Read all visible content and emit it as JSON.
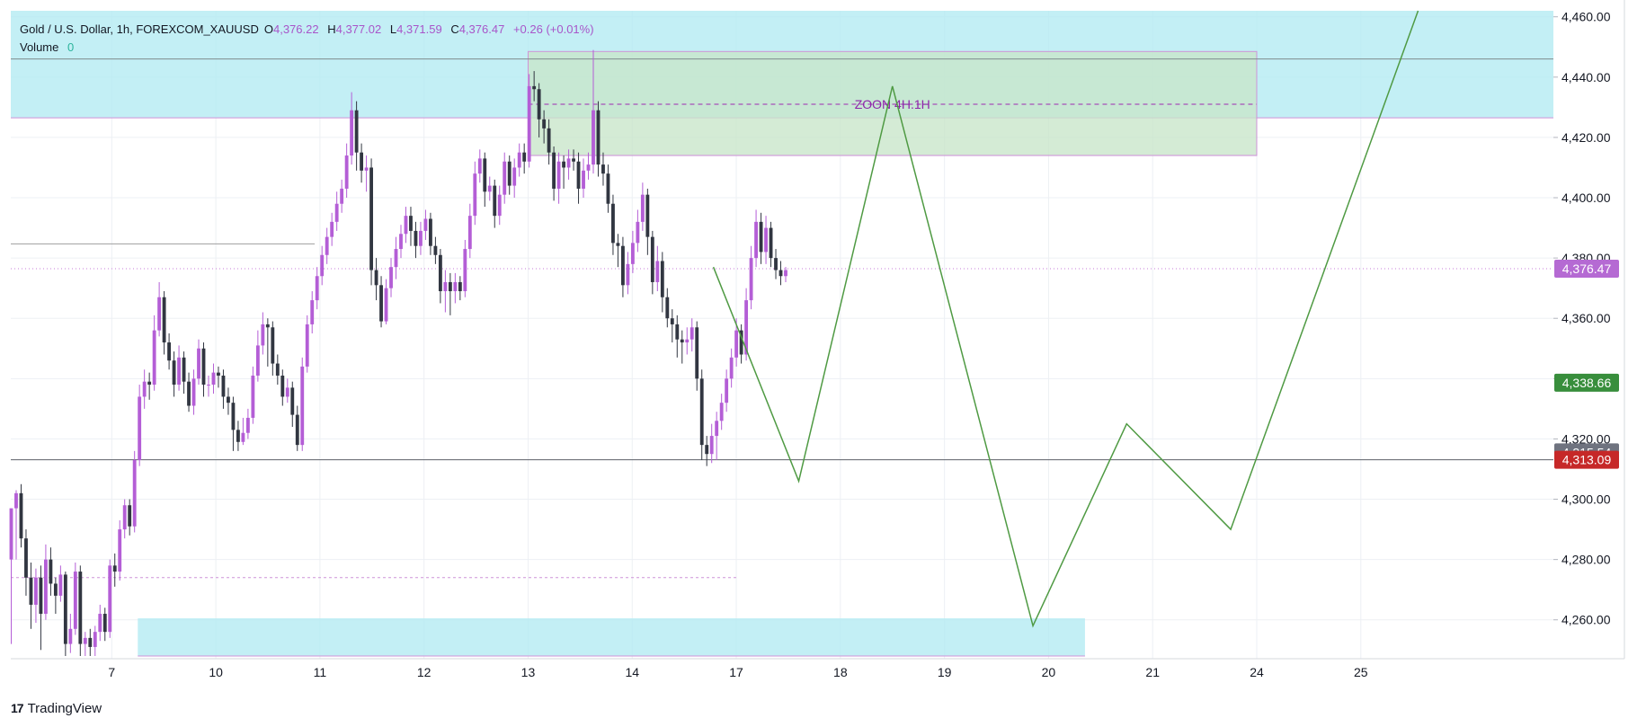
{
  "header": {
    "title": "Gold / U.S. Dollar, 1h, FOREXCOM_XAUUSD",
    "ohlc": {
      "open_label": "O",
      "open": "4,376.22",
      "high_label": "H",
      "high": "4,377.02",
      "low_label": "L",
      "low": "4,371.59",
      "close_label": "C",
      "close": "4,376.47",
      "change": "+0.26 (+0.01%)"
    },
    "volume_label": "Volume",
    "volume_value": "0"
  },
  "brand": {
    "label": "TradingView",
    "icon": "tradingview-logo-icon"
  },
  "chart_data": {
    "type": "candlestick",
    "symbol": "FOREXCOM_XAUUSD",
    "interval": "1h",
    "ylim": [
      4248,
      4462
    ],
    "yticks": [
      "4,460.00",
      "4,440.00",
      "4,420.00",
      "4,400.00",
      "4,380.00",
      "4,360.00",
      "4,340.00",
      "4,320.00",
      "4,300.00",
      "4,280.00",
      "4,260.00"
    ],
    "xticks": [
      "7",
      "10",
      "11",
      "12",
      "13",
      "14",
      "17",
      "18",
      "19",
      "20",
      "21",
      "24",
      "25"
    ],
    "xtick_pos": [
      1,
      2,
      3,
      4,
      5,
      6,
      7,
      8,
      9,
      10,
      11,
      12,
      13
    ],
    "xlim": [
      0.03,
      14.85
    ],
    "price_labels": [
      {
        "text": "4,376.47",
        "value": 4376.47,
        "color": "#b56ad3"
      },
      {
        "text": "4,338.66",
        "value": 4338.66,
        "color": "#388e3c"
      },
      {
        "text": "4,315.54",
        "value": 4315.54,
        "color": "#6f737f"
      },
      {
        "text": "4,313.09",
        "value": 4313.09,
        "color": "#c62828"
      }
    ],
    "zones": [
      {
        "x0": 0.03,
        "x1": 14.85,
        "y0": 4426.5,
        "y1": 4462,
        "fill": "#b2ebf2"
      },
      {
        "x0": 1.25,
        "x1": 10.35,
        "y0": 4248,
        "y1": 4260.5,
        "fill": "#b2ebf2"
      },
      {
        "x0": 5.0,
        "x1": 12.0,
        "y0": 4414,
        "y1": 4448.5,
        "fill": "#c8e6c9"
      }
    ],
    "zone_label": "ZOON 4H.1H",
    "zone_label_value": 4431,
    "horizontal_lines": [
      {
        "value": 4313.09,
        "x0": 0.03,
        "x1": 14.85,
        "color": "#5d6068"
      },
      {
        "value": 4446,
        "x0": 0.03,
        "x1": 14.85,
        "color": "#7f8c8d"
      },
      {
        "value": 4384.7,
        "x0": 0.03,
        "x1": 2.95,
        "color": "#9e9e9e"
      },
      {
        "value": 4274,
        "x0": 0.03,
        "x1": 7.0,
        "color": "#ce93d8",
        "dashed": true
      }
    ],
    "current_price": 4376.47,
    "projection": [
      [
        6.78,
        4377
      ],
      [
        7.6,
        4306
      ],
      [
        8.5,
        4437
      ],
      [
        9.85,
        4258
      ],
      [
        10.75,
        4325
      ],
      [
        11.75,
        4290
      ],
      [
        13.55,
        4462
      ]
    ],
    "candles": [
      [
        0,
        4280,
        4297,
        4292,
        4252
      ],
      [
        0,
        4297,
        4302,
        4303,
        4280
      ],
      [
        0,
        4302,
        4287,
        4305,
        4284
      ],
      [
        0,
        4287,
        4274,
        4290,
        4268
      ],
      [
        0,
        4274,
        4265,
        4279,
        4257
      ],
      [
        0,
        4265,
        4274,
        4277,
        4259
      ],
      [
        0,
        4274,
        4262,
        4278,
        4250
      ],
      [
        0,
        4262,
        4280,
        4285,
        4260
      ],
      [
        0,
        4280,
        4272,
        4284,
        4268
      ],
      [
        0,
        4272,
        4268,
        4274,
        4262
      ],
      [
        0,
        4268,
        4275,
        4278,
        4266
      ],
      [
        0,
        4275,
        4252,
        4276,
        4248
      ],
      [
        0,
        4252,
        4257,
        4262,
        4249
      ],
      [
        0,
        4257,
        4276,
        4279,
        4255
      ],
      [
        0,
        4276,
        4252,
        4278,
        4248
      ],
      [
        1,
        4252,
        4254,
        4256,
        4248
      ],
      [
        1,
        4254,
        4251,
        4257,
        4248
      ],
      [
        1,
        4251,
        4256,
        4258,
        4248
      ],
      [
        1,
        4256,
        4262,
        4265,
        4253
      ],
      [
        1,
        4262,
        4256,
        4264,
        4253
      ],
      [
        1,
        4256,
        4278,
        4280,
        4254
      ],
      [
        1,
        4278,
        4276,
        4282,
        4271
      ],
      [
        1,
        4276,
        4290,
        4293,
        4273
      ],
      [
        1,
        4290,
        4298,
        4300,
        4287
      ],
      [
        1,
        4298,
        4291,
        4300,
        4288
      ],
      [
        1,
        4291,
        4313,
        4316,
        4289
      ],
      [
        1,
        4313,
        4334,
        4338,
        4311
      ],
      [
        1,
        4334,
        4339,
        4343,
        4330
      ],
      [
        1,
        4339,
        4338,
        4342,
        4333
      ],
      [
        1,
        4338,
        4356,
        4361,
        4336
      ],
      [
        1,
        4356,
        4367,
        4372,
        4354
      ],
      [
        1,
        4367,
        4352,
        4369,
        4348
      ],
      [
        1,
        4352,
        4346,
        4355,
        4343
      ],
      [
        1,
        4346,
        4338,
        4349,
        4334
      ],
      [
        1,
        4338,
        4347,
        4351,
        4336
      ],
      [
        1,
        4347,
        4339,
        4349,
        4335
      ],
      [
        1,
        4339,
        4331,
        4342,
        4329
      ],
      [
        1,
        4331,
        4340,
        4343,
        4328
      ],
      [
        1,
        4340,
        4350,
        4353,
        4338
      ],
      [
        1,
        4350,
        4338,
        4352,
        4334
      ],
      [
        1,
        4338,
        4338,
        4341,
        4334
      ],
      [
        1,
        4338,
        4342,
        4345,
        4335
      ],
      [
        1,
        4342,
        4341,
        4344,
        4337
      ],
      [
        1,
        4341,
        4334,
        4343,
        4330
      ],
      [
        1,
        4334,
        4332,
        4337,
        4328
      ],
      [
        2,
        4332,
        4323,
        4334,
        4316
      ],
      [
        2,
        4323,
        4319,
        4326,
        4316
      ],
      [
        2,
        4319,
        4322,
        4327,
        4318
      ],
      [
        2,
        4322,
        4327,
        4330,
        4320
      ],
      [
        2,
        4327,
        4341,
        4344,
        4325
      ],
      [
        2,
        4341,
        4351,
        4356,
        4339
      ],
      [
        2,
        4351,
        4358,
        4362,
        4348
      ],
      [
        2,
        4358,
        4357,
        4360,
        4344
      ],
      [
        2,
        4357,
        4345,
        4359,
        4341
      ],
      [
        2,
        4345,
        4341,
        4348,
        4338
      ],
      [
        2,
        4341,
        4334,
        4343,
        4331
      ],
      [
        2,
        4334,
        4337,
        4340,
        4332
      ],
      [
        2,
        4337,
        4328,
        4339,
        4324
      ],
      [
        2,
        4328,
        4318,
        4331,
        4316
      ],
      [
        2,
        4318,
        4344,
        4347,
        4316
      ],
      [
        2,
        4344,
        4358,
        4361,
        4342
      ],
      [
        2,
        4358,
        4366,
        4369,
        4355
      ],
      [
        2,
        4366,
        4374,
        4377,
        4363
      ],
      [
        2,
        4374,
        4381,
        4384,
        4371
      ],
      [
        2,
        4381,
        4387,
        4390,
        4378
      ],
      [
        2,
        4387,
        4392,
        4395,
        4384
      ],
      [
        2,
        4392,
        4398,
        4402,
        4389
      ],
      [
        2,
        4398,
        4403,
        4406,
        4395
      ],
      [
        2,
        4403,
        4414,
        4418,
        4400
      ],
      [
        2,
        4414,
        4429,
        4435,
        4411
      ],
      [
        2,
        4429,
        4415,
        4432,
        4409
      ],
      [
        2,
        4415,
        4409,
        4418,
        4405
      ],
      [
        2,
        4409,
        4410,
        4414,
        4402
      ],
      [
        2,
        4410,
        4376,
        4413,
        4371
      ],
      [
        2,
        4376,
        4371,
        4380,
        4366
      ],
      [
        2,
        4371,
        4359,
        4374,
        4357
      ],
      [
        3,
        4359,
        4370,
        4373,
        4358
      ],
      [
        3,
        4370,
        4377,
        4380,
        4367
      ],
      [
        3,
        4377,
        4383,
        4387,
        4373
      ],
      [
        3,
        4383,
        4388,
        4391,
        4380
      ],
      [
        3,
        4388,
        4394,
        4397,
        4385
      ],
      [
        3,
        4394,
        4389,
        4397,
        4384
      ],
      [
        3,
        4389,
        4384,
        4392,
        4380
      ],
      [
        3,
        4384,
        4389,
        4392,
        4381
      ],
      [
        3,
        4389,
        4393,
        4396,
        4386
      ],
      [
        3,
        4393,
        4384,
        4395,
        4381
      ],
      [
        3,
        4384,
        4381,
        4387,
        4378
      ],
      [
        3,
        4381,
        4369,
        4383,
        4365
      ],
      [
        3,
        4369,
        4372,
        4376,
        4362
      ],
      [
        3,
        4372,
        4369,
        4375,
        4361
      ],
      [
        3,
        4369,
        4372,
        4375,
        4365
      ],
      [
        3,
        4372,
        4369,
        4374,
        4366
      ],
      [
        3,
        4369,
        4383,
        4386,
        4367
      ],
      [
        3,
        4383,
        4394,
        4398,
        4380
      ],
      [
        3,
        4394,
        4408,
        4412,
        4391
      ],
      [
        3,
        4408,
        4413,
        4416,
        4405
      ],
      [
        3,
        4413,
        4402,
        4415,
        4397
      ],
      [
        3,
        4402,
        4404,
        4407,
        4399
      ],
      [
        3,
        4404,
        4394,
        4406,
        4390
      ],
      [
        3,
        4394,
        4401,
        4404,
        4391
      ],
      [
        3,
        4401,
        4412,
        4415,
        4398
      ],
      [
        3,
        4412,
        4404,
        4414,
        4401
      ],
      [
        3,
        4404,
        4410,
        4413,
        4400
      ],
      [
        4,
        4410,
        4415,
        4418,
        4407
      ],
      [
        4,
        4415,
        4412,
        4418,
        4408
      ],
      [
        4,
        4412,
        4437,
        4441,
        4410
      ],
      [
        4,
        4437,
        4436,
        4442,
        4432
      ],
      [
        4,
        4436,
        4426,
        4438,
        4420
      ],
      [
        4,
        4426,
        4423,
        4429,
        4418
      ],
      [
        4,
        4423,
        4415,
        4426,
        4411
      ],
      [
        4,
        4415,
        4403,
        4417,
        4399
      ],
      [
        4,
        4403,
        4412,
        4415,
        4398
      ],
      [
        4,
        4412,
        4410,
        4414,
        4403
      ],
      [
        4,
        4410,
        4413,
        4416,
        4406
      ],
      [
        4,
        4413,
        4412,
        4416,
        4409
      ],
      [
        4,
        4412,
        4403,
        4415,
        4398
      ],
      [
        4,
        4403,
        4409,
        4413,
        4400
      ],
      [
        5,
        4409,
        4411,
        4415,
        4406
      ],
      [
        5,
        4411,
        4429,
        4449,
        4408
      ],
      [
        5,
        4429,
        4411,
        4432,
        4407
      ],
      [
        5,
        4411,
        4408,
        4415,
        4404
      ],
      [
        5,
        4408,
        4398,
        4411,
        4395
      ],
      [
        5,
        4398,
        4385,
        4401,
        4381
      ],
      [
        5,
        4385,
        4384,
        4388,
        4377
      ],
      [
        5,
        4384,
        4371,
        4387,
        4367
      ],
      [
        5,
        4371,
        4378,
        4382,
        4368
      ],
      [
        5,
        4378,
        4385,
        4389,
        4375
      ],
      [
        5,
        4385,
        4392,
        4396,
        4382
      ],
      [
        5,
        4392,
        4401,
        4405,
        4389
      ],
      [
        5,
        4401,
        4387,
        4403,
        4381
      ],
      [
        5,
        4387,
        4372,
        4389,
        4368
      ],
      [
        5,
        4372,
        4379,
        4384,
        4369
      ],
      [
        5,
        4379,
        4367,
        4382,
        4362
      ],
      [
        5,
        4367,
        4360,
        4370,
        4357
      ],
      [
        5,
        4360,
        4358,
        4363,
        4352
      ],
      [
        5,
        4358,
        4353,
        4361,
        4347
      ],
      [
        5,
        4353,
        4352,
        4356,
        4345
      ],
      [
        5,
        4352,
        4353,
        4357,
        4348
      ],
      [
        5,
        4353,
        4357,
        4360,
        4349
      ],
      [
        5,
        4357,
        4340,
        4359,
        4336
      ],
      [
        6,
        4340,
        4318,
        4343,
        4313
      ],
      [
        6,
        4318,
        4315,
        4321,
        4311
      ],
      [
        6,
        4315,
        4321,
        4325,
        4312
      ],
      [
        6,
        4321,
        4326,
        4329,
        4313
      ],
      [
        6,
        4326,
        4332,
        4335,
        4323
      ],
      [
        6,
        4332,
        4340,
        4343,
        4329
      ],
      [
        6,
        4340,
        4347,
        4350,
        4337
      ],
      [
        6,
        4347,
        4356,
        4360,
        4344
      ],
      [
        6,
        4356,
        4348,
        4358,
        4345
      ],
      [
        6,
        4348,
        4366,
        4370,
        4346
      ],
      [
        6,
        4366,
        4380,
        4384,
        4363
      ],
      [
        6,
        4380,
        4392,
        4396,
        4377
      ],
      [
        6,
        4392,
        4382,
        4395,
        4378
      ],
      [
        6,
        4382,
        4390,
        4394,
        4378
      ],
      [
        6,
        4390,
        4380,
        4392,
        4377
      ],
      [
        6,
        4380,
        4376,
        4383,
        4373
      ],
      [
        6,
        4376,
        4374,
        4379,
        4371
      ],
      [
        6,
        4374,
        4376,
        4377,
        4372
      ]
    ],
    "title": "",
    "xlabel": "",
    "ylabel": ""
  },
  "colors": {
    "bull": "#b45ed6",
    "bear": "#313641",
    "projection": "#4f9a43",
    "grid": "#edf0f4",
    "zone_text": "#8e24aa",
    "axis_text": "#131722"
  }
}
